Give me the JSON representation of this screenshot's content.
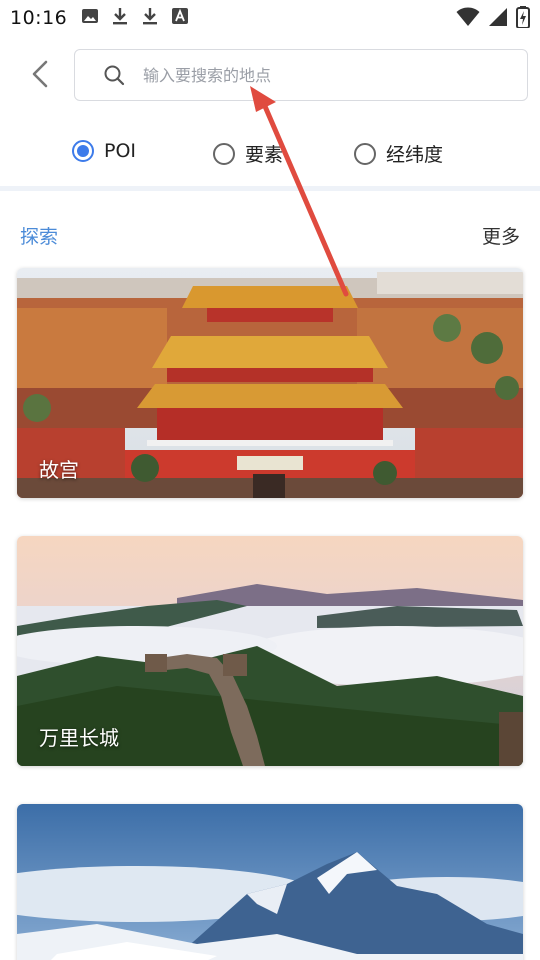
{
  "status_bar": {
    "time": "10:16",
    "icons": [
      "image-icon",
      "download-icon",
      "download-icon",
      "font-a-icon"
    ],
    "right_icons": [
      "wifi-icon",
      "signal-icon",
      "battery-charging-icon"
    ]
  },
  "search": {
    "placeholder": "输入要搜索的地点"
  },
  "search_types": {
    "options": [
      {
        "label": "POI",
        "checked": true
      },
      {
        "label": "要素",
        "checked": false
      },
      {
        "label": "经纬度",
        "checked": false
      }
    ]
  },
  "explore": {
    "title": "探索",
    "more": "更多",
    "cards": [
      {
        "label": "故宫"
      },
      {
        "label": "万里长城"
      },
      {
        "label": ""
      }
    ]
  },
  "colors": {
    "accent": "#3d7bea",
    "section_title": "#4b8bd8",
    "annotation_arrow": "#e04b3f"
  }
}
